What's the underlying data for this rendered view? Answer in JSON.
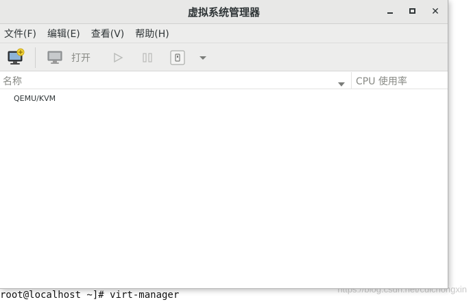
{
  "window": {
    "title": "虚拟系统管理器",
    "controls": {
      "minimize": "minimize-icon",
      "maximize": "maximize-icon",
      "close": "close-icon"
    }
  },
  "menubar": {
    "items": [
      {
        "label": "文件(F)"
      },
      {
        "label": "编辑(E)"
      },
      {
        "label": "查看(V)"
      },
      {
        "label": "帮助(H)"
      }
    ]
  },
  "toolbar": {
    "new_vm_icon": "new-vm-icon",
    "open_label": "打开",
    "run_icon": "play-icon",
    "pause_icon": "pause-icon",
    "stop_icon": "stop-icon",
    "dropdown_icon": "chevron-down-icon"
  },
  "list": {
    "columns": [
      {
        "label": "名称"
      },
      {
        "label": "CPU 使用率"
      }
    ],
    "rows": [
      {
        "name": "QEMU/KVM"
      }
    ]
  },
  "terminal": {
    "partial_line": "· · ·",
    "command_line": "root@localhost ~]# virt-manager"
  },
  "watermark": "https://blog.csdn.net/cuichongxin",
  "colors": {
    "titlebar_bg": "#e8e8e7",
    "toolbar_bg": "#ededec",
    "text": "#2e3436",
    "disabled_text": "#888a85"
  }
}
